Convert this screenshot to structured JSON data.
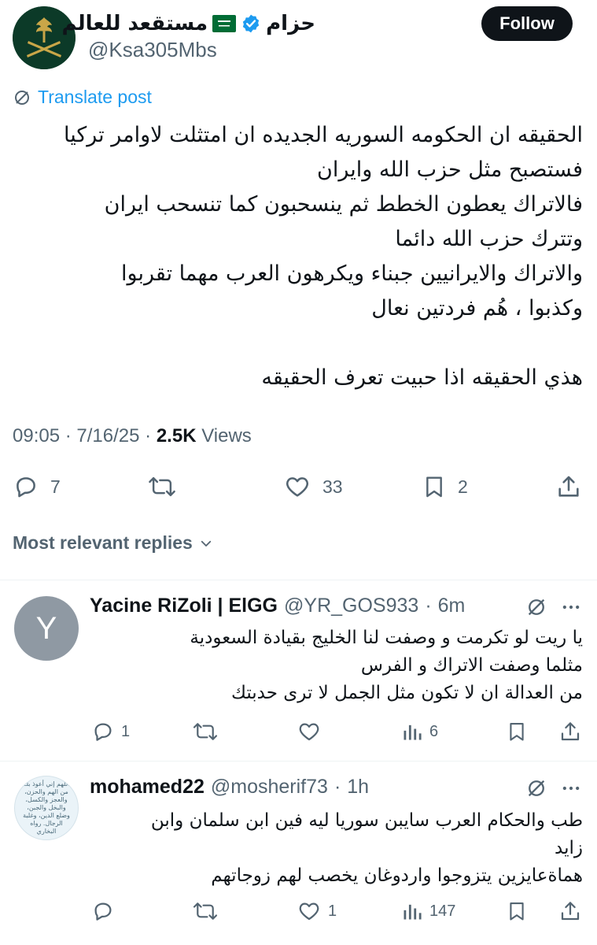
{
  "author": {
    "name_text": "مستقعد للعالم",
    "name_prefix": "حزام",
    "handle": "@Ksa305Mbs",
    "verified": true
  },
  "follow_label": "Follow",
  "translate_label": "Translate post",
  "post_text": "الحقيقه ان الحكومه السوريه الجديده ان امتثلت لاوامر تركيا\nفستصبح مثل حزب الله وايران\nفالاتراك يعطون الخطط ثم ينسحبون كما تنسحب ايران\nوتترك حزب الله دائما\nوالاتراك والايرانيين  جبناء  ويكرهون العرب مهما تقربوا\nوكذبوا ، هُم   فردتين نعال\n\nهذي  الحقيقه اذا حبيت تعرف الحقيقه",
  "meta": {
    "time": "09:05",
    "date": "7/16/25",
    "views_count": "2.5K",
    "views_label": "Views"
  },
  "actions": {
    "replies": "7",
    "likes": "33",
    "bookmarks": "2"
  },
  "relevant_label": "Most relevant replies",
  "replies": [
    {
      "avatar_letter": "Y",
      "name": "Yacine RiZoli | ElGG",
      "handle": "@YR_GOS933",
      "time": "6m",
      "text": "يا ريت لو تكرمت و وصفت لنا الخليج بقيادة السعودية\nمثلما وصفت الاتراك و الفرس\nمن العدالة ان لا تكون مثل الجمل لا ترى حدبتك",
      "reply_count": "1",
      "like_count": "",
      "views": "6"
    },
    {
      "avatar_text": "اللهم إني أعوذ بك من الهم والحزن، والعجز والكسل، والبخل والجبن، وضلع الدين، وغلبة الرجال. رواه البخاري",
      "name": "mohamed22",
      "handle": "@mosherif73",
      "time": "1h",
      "text": "طب والحكام العرب سايبن سوريا ليه فين ابن سلمان وابن\nزايد\nهماةعايزين يتزوجوا واردوغان يخصب لهم زوجاتهم",
      "reply_count": "",
      "like_count": "1",
      "views": "147"
    }
  ],
  "colors": {
    "accent": "#1d9bf0",
    "muted": "#536471",
    "text": "#0f1419",
    "flag_green": "#006c35"
  }
}
